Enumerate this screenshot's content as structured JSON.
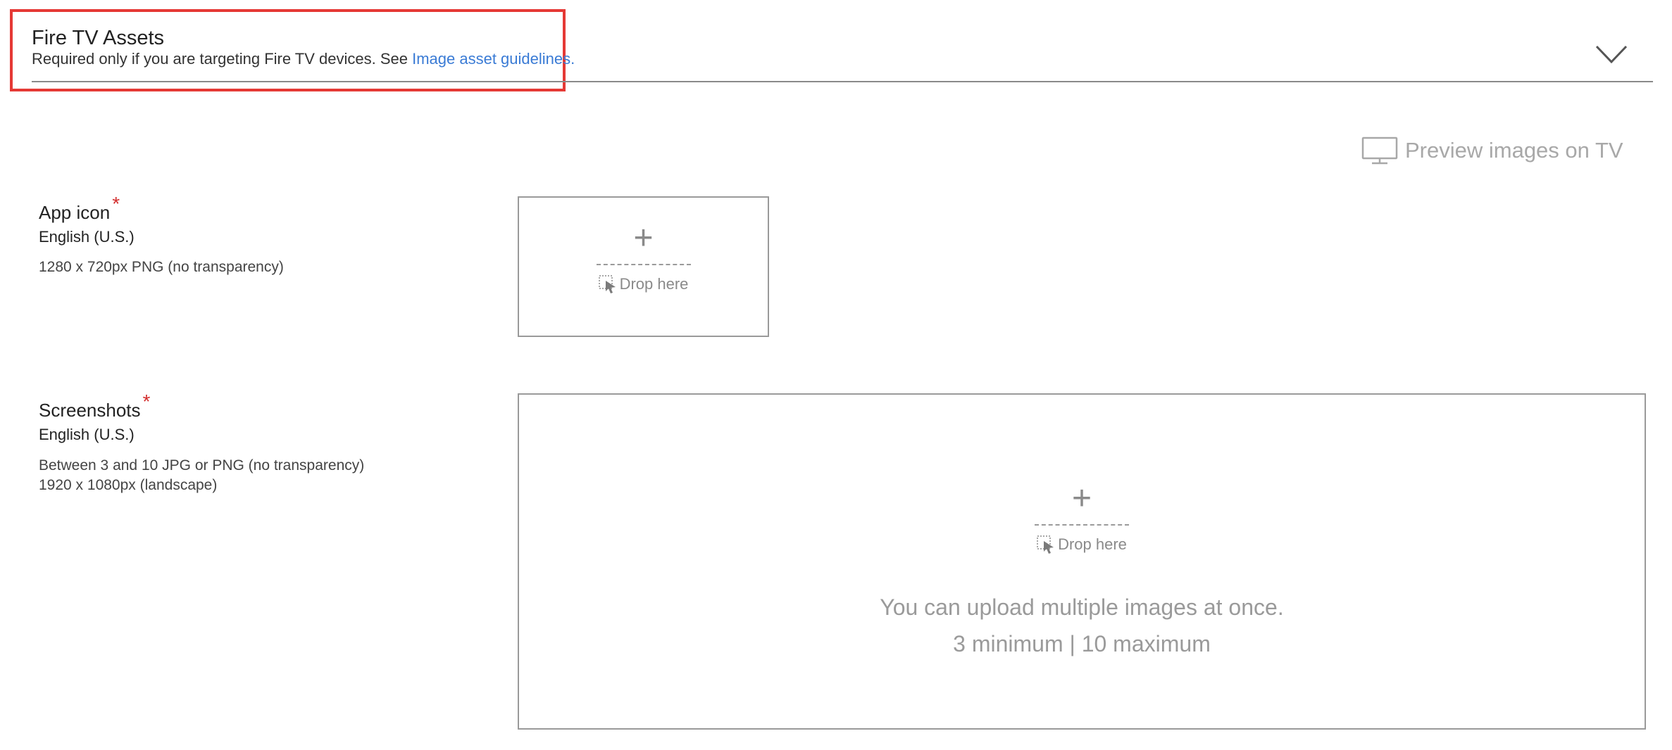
{
  "section": {
    "title": "Fire TV Assets",
    "subtitle_prefix": "Required only if you are targeting Fire TV devices. See ",
    "subtitle_link": "Image asset guidelines."
  },
  "preview": {
    "label": "Preview images on TV"
  },
  "app_icon": {
    "label": "App icon",
    "required": "*",
    "locale": "English (U.S.)",
    "description": "1280 x 720px PNG (no transparency)",
    "drop_label": "Drop here"
  },
  "screenshots": {
    "label": "Screenshots",
    "required": "*",
    "locale": "English (U.S.)",
    "description_line1": "Between 3 and 10 JPG or PNG (no transparency)",
    "description_line2": "1920 x 1080px (landscape)",
    "drop_label": "Drop here",
    "note_line1": "You can upload multiple images at once.",
    "note_line2": "3 minimum | 10 maximum"
  },
  "colors": {
    "highlight": "#e53935",
    "link": "#3a7bd5",
    "required": "#d32f2f"
  }
}
